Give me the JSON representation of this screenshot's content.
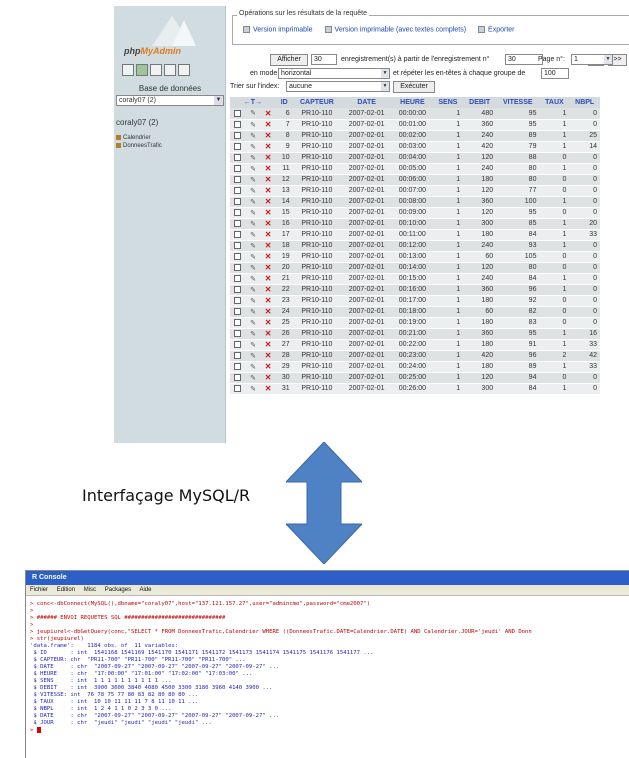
{
  "pma": {
    "logo": {
      "text_pre": "php",
      "text_brand": "MyAdmin"
    },
    "db_label": "Base de données",
    "db_selected": "coraly07 (2)",
    "db_name": "coraly07 (2)",
    "tables": [
      "Calendrier",
      "DonneesTrafic"
    ],
    "fieldset_legend": "Opérations sur les résultats de la requête",
    "op_links": [
      "Version imprimable",
      "Version imprimable (avec textes complets)",
      "Exporter"
    ],
    "controls": {
      "show_button": "Afficher",
      "rows_value": "30",
      "text_from_record": "enregistrement(s) à partir de l'enregistrement n°",
      "start_value": "30",
      "next_button": ">",
      "last_button": ">>",
      "page_label": "Page n°:",
      "page_value": "1",
      "mode_label": "en mode",
      "mode_value": "horizontal",
      "repeat_text": "et répéter les en-têtes à chaque groupe de",
      "repeat_value": "100",
      "sort_label": "Trier sur l'index:",
      "sort_value": "aucune",
      "execute_button": "Exécuter"
    },
    "columns": [
      "ID",
      "CAPTEUR",
      "DATE",
      "HEURE",
      "SENS",
      "DEBIT",
      "VITESSE",
      "TAUX",
      "NBPL"
    ],
    "rows": [
      [
        "6",
        "PR10-110",
        "2007-02-01",
        "00:00:00",
        "1",
        "480",
        "95",
        "1",
        "0"
      ],
      [
        "7",
        "PR10-110",
        "2007-02-01",
        "00:01:00",
        "1",
        "360",
        "95",
        "1",
        "0"
      ],
      [
        "8",
        "PR10-110",
        "2007-02-01",
        "00:02:00",
        "1",
        "240",
        "89",
        "1",
        "25"
      ],
      [
        "9",
        "PR10-110",
        "2007-02-01",
        "00:03:00",
        "1",
        "420",
        "79",
        "1",
        "14"
      ],
      [
        "10",
        "PR10-110",
        "2007-02-01",
        "00:04:00",
        "1",
        "120",
        "88",
        "0",
        "0"
      ],
      [
        "11",
        "PR10-110",
        "2007-02-01",
        "00:05:00",
        "1",
        "240",
        "80",
        "1",
        "0"
      ],
      [
        "12",
        "PR10-110",
        "2007-02-01",
        "00:06:00",
        "1",
        "180",
        "80",
        "0",
        "0"
      ],
      [
        "13",
        "PR10-110",
        "2007-02-01",
        "00:07:00",
        "1",
        "120",
        "77",
        "0",
        "0"
      ],
      [
        "14",
        "PR10-110",
        "2007-02-01",
        "00:08:00",
        "1",
        "360",
        "100",
        "1",
        "0"
      ],
      [
        "15",
        "PR10-110",
        "2007-02-01",
        "00:09:00",
        "1",
        "120",
        "95",
        "0",
        "0"
      ],
      [
        "16",
        "PR10-110",
        "2007-02-01",
        "00:10:00",
        "1",
        "300",
        "85",
        "1",
        "20"
      ],
      [
        "17",
        "PR10-110",
        "2007-02-01",
        "00:11:00",
        "1",
        "180",
        "84",
        "1",
        "33"
      ],
      [
        "18",
        "PR10-110",
        "2007-02-01",
        "00:12:00",
        "1",
        "240",
        "93",
        "1",
        "0"
      ],
      [
        "19",
        "PR10-110",
        "2007-02-01",
        "00:13:00",
        "1",
        "60",
        "105",
        "0",
        "0"
      ],
      [
        "20",
        "PR10-110",
        "2007-02-01",
        "00:14:00",
        "1",
        "120",
        "80",
        "0",
        "0"
      ],
      [
        "21",
        "PR10-110",
        "2007-02-01",
        "00:15:00",
        "1",
        "240",
        "84",
        "1",
        "0"
      ],
      [
        "22",
        "PR10-110",
        "2007-02-01",
        "00:16:00",
        "1",
        "360",
        "96",
        "1",
        "0"
      ],
      [
        "23",
        "PR10-110",
        "2007-02-01",
        "00:17:00",
        "1",
        "180",
        "92",
        "0",
        "0"
      ],
      [
        "24",
        "PR10-110",
        "2007-02-01",
        "00:18:00",
        "1",
        "60",
        "82",
        "0",
        "0"
      ],
      [
        "25",
        "PR10-110",
        "2007-02-01",
        "00:19:00",
        "1",
        "180",
        "83",
        "0",
        "0"
      ],
      [
        "26",
        "PR10-110",
        "2007-02-01",
        "00:21:00",
        "1",
        "360",
        "95",
        "1",
        "16"
      ],
      [
        "27",
        "PR10-110",
        "2007-02-01",
        "00:22:00",
        "1",
        "180",
        "91",
        "1",
        "33"
      ],
      [
        "28",
        "PR10-110",
        "2007-02-01",
        "00:23:00",
        "1",
        "420",
        "96",
        "2",
        "42"
      ],
      [
        "29",
        "PR10-110",
        "2007-02-01",
        "00:24:00",
        "1",
        "180",
        "89",
        "1",
        "33"
      ],
      [
        "30",
        "PR10-110",
        "2007-02-01",
        "00:25:00",
        "1",
        "120",
        "94",
        "0",
        "0"
      ],
      [
        "31",
        "PR10-110",
        "2007-02-01",
        "00:26:00",
        "1",
        "300",
        "84",
        "1",
        "0"
      ]
    ]
  },
  "caption": "Interfaçage MySQL/R",
  "arrow_color": "#4f82c4",
  "rconsole": {
    "title": "R Console",
    "menu": [
      "Fichier",
      "Edition",
      "Misc",
      "Packages",
      "Aide"
    ],
    "lines": [
      {
        "cls": "red",
        "text": "> conc<-dbConnect(MySQL(),dbname=\"coraly07\",host=\"137.121.157.27\",user=\"admincme\",password=\"cme2007\")"
      },
      {
        "cls": "red",
        "text": ">"
      },
      {
        "cls": "red",
        "text": "> ###### ENVOI REQUETES SQL ##############################"
      },
      {
        "cls": "red",
        "text": ">"
      },
      {
        "cls": "red",
        "text": "> jeupiurel<-dbGetQuery(conc,\"SELECT * FROM DonneesTrafic,Calendrier WHERE ((DonneesTrafic.DATE=Calendrier.DATE) AND Calendrier.JOUR='jeudi' AND Donn"
      },
      {
        "cls": "red",
        "text": "> str(jeupiurel)"
      },
      {
        "cls": "blue",
        "text": "'data.frame':    1184 obs. of  11 variables:"
      },
      {
        "cls": "blue",
        "text": " $ ID       : int  1541168 1541169 1541170 1541171 1541172 1541173 1541174 1541175 1541176 1541177 ..."
      },
      {
        "cls": "blue",
        "text": " $ CAPTEUR: chr  \"PR11-700\" \"PR11-700\" \"PR11-700\" \"PR11-700\" ..."
      },
      {
        "cls": "blue",
        "text": " $ DATE     : chr  \"2007-09-27\" \"2007-09-27\" \"2007-09-27\" \"2007-09-27\" ..."
      },
      {
        "cls": "blue",
        "text": " $ HEURE    : chr  \"17:00:00\" \"17:01:00\" \"17:02:00\" \"17:03:00\" ..."
      },
      {
        "cls": "blue",
        "text": " $ SENS     : int  1 1 1 1 1 1 1 1 1 1 ..."
      },
      {
        "cls": "blue",
        "text": " $ DEBIT    : int  3900 3600 3840 4080 4500 3300 3180 3960 4140 3900 ..."
      },
      {
        "cls": "blue",
        "text": " $ VITESSE: int  76 78 75 77 80 83 82 80 80 80 ..."
      },
      {
        "cls": "blue",
        "text": " $ TAUX     : int  10 10 11 11 11 7 8 11 10 11 ..."
      },
      {
        "cls": "blue",
        "text": " $ NBPL     : int  1 2 4 1 1 0 2 3 3 0 ..."
      },
      {
        "cls": "blue",
        "text": " $ DATE     : chr  \"2007-09-27\" \"2007-09-27\" \"2007-09-27\" \"2007-09-27\" ..."
      },
      {
        "cls": "blue",
        "text": " $ JOUR     : chr  \"jeudi\" \"jeudi\" \"jeudi\" \"jeudi\" ..."
      },
      {
        "cls": "red",
        "text": "> "
      }
    ]
  }
}
